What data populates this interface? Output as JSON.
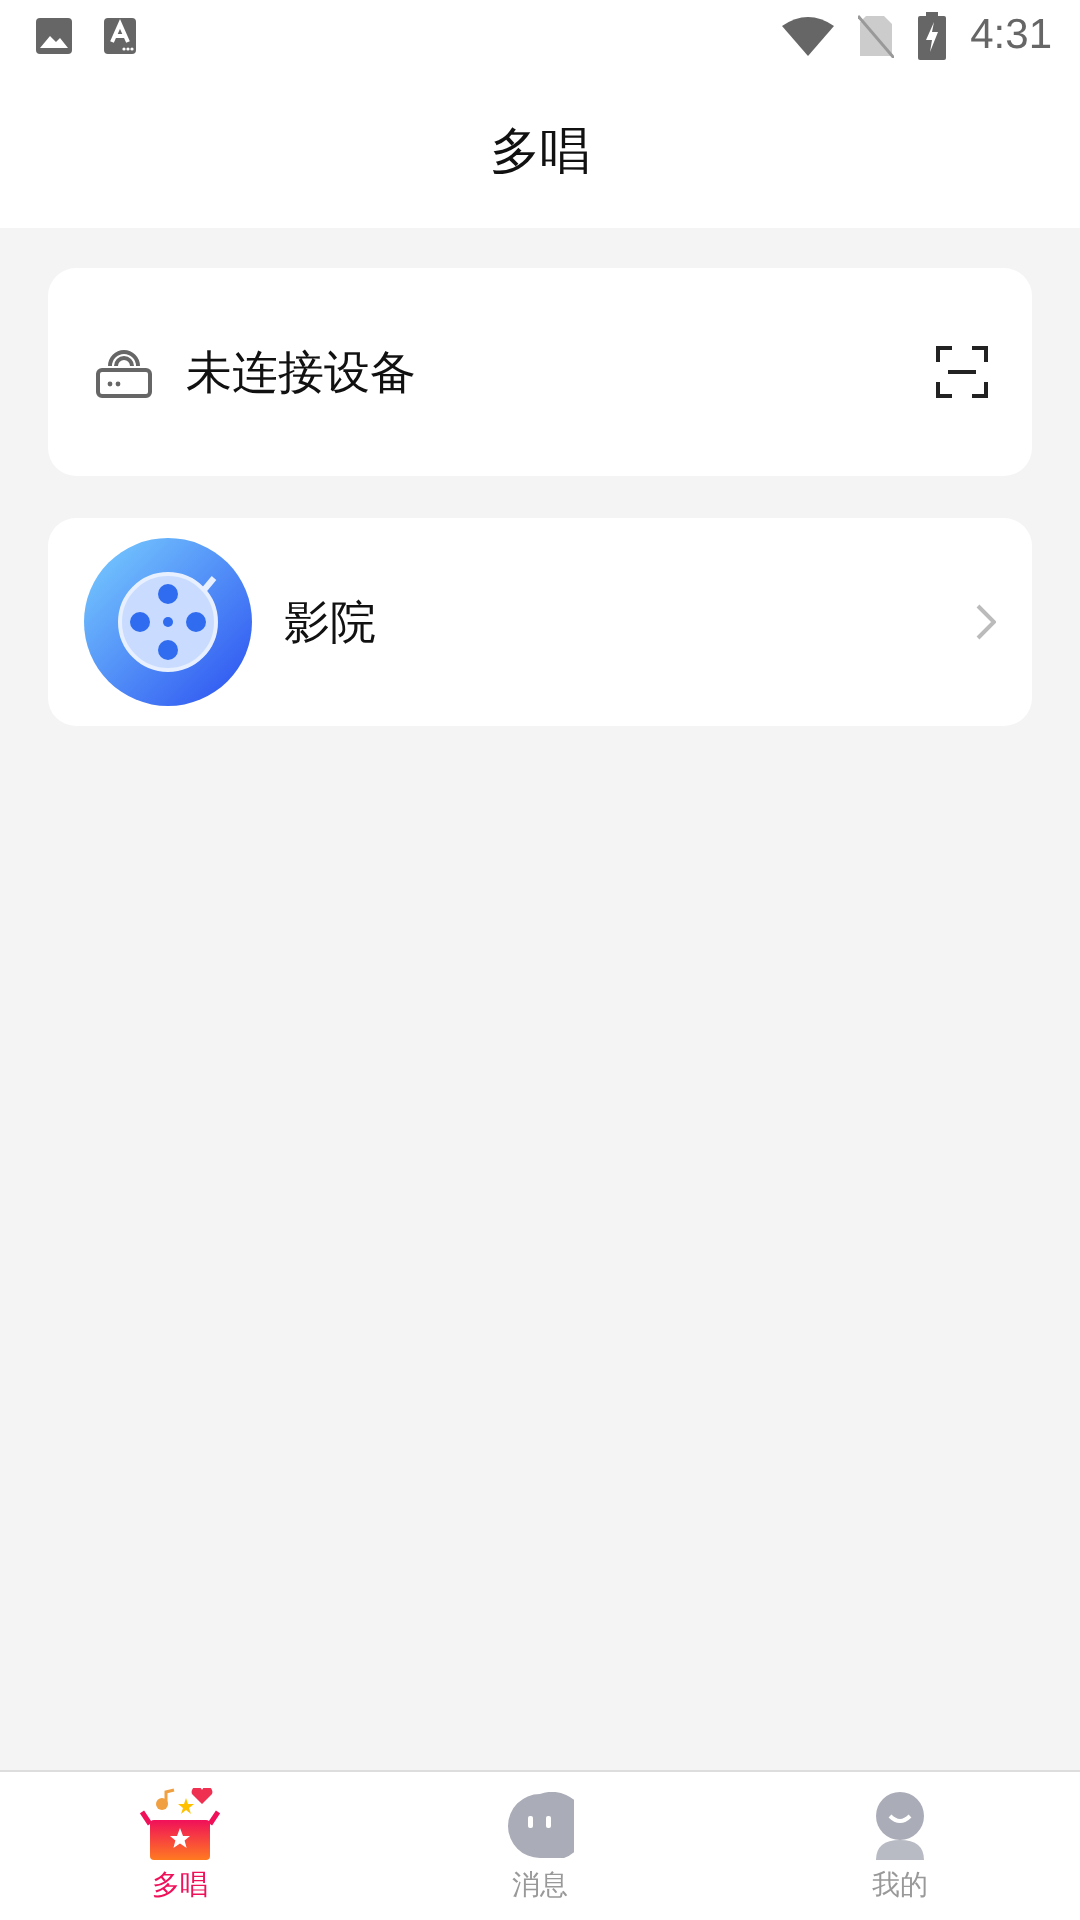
{
  "status_bar": {
    "time": "4:31"
  },
  "header": {
    "title": "多唱"
  },
  "device_card": {
    "label": "未连接设备"
  },
  "entries": [
    {
      "label": "影院"
    }
  ],
  "tabs": [
    {
      "label": "多唱",
      "kind": "sing",
      "selected": true
    },
    {
      "label": "消息",
      "kind": "message",
      "selected": false
    },
    {
      "label": "我的",
      "kind": "profile",
      "selected": false
    }
  ]
}
